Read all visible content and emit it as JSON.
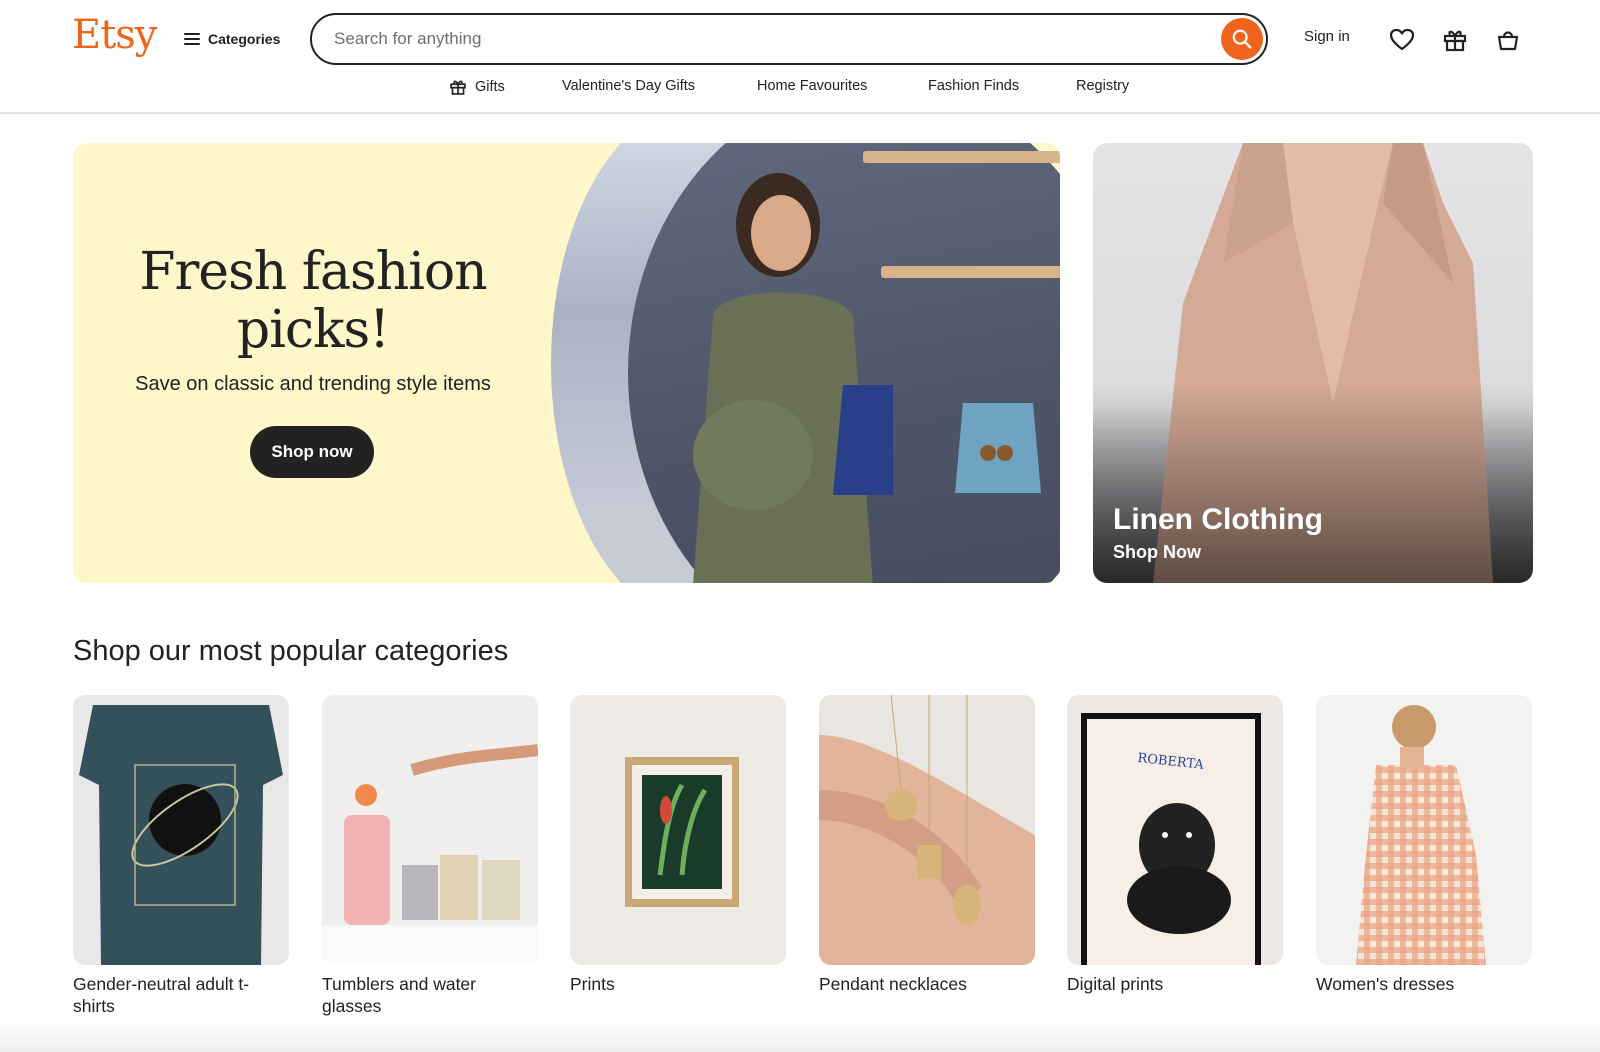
{
  "header": {
    "logo": "Etsy",
    "categories_label": "Categories",
    "search_placeholder": "Search for anything",
    "sign_in": "Sign in"
  },
  "subnav": {
    "items": [
      "Gifts",
      "Valentine's Day Gifts",
      "Home Favourites",
      "Fashion Finds",
      "Registry"
    ]
  },
  "hero": {
    "title_line1": "Fresh fashion",
    "title_line2": "picks!",
    "subtitle": "Save on classic and trending style items",
    "button": "Shop now"
  },
  "side_card": {
    "title": "Linen Clothing",
    "subtitle": "Shop Now"
  },
  "popular": {
    "title": "Shop our most popular categories",
    "items": [
      {
        "label": "Gender-neutral adult t-shirts"
      },
      {
        "label": "Tumblers and water glasses"
      },
      {
        "label": "Prints"
      },
      {
        "label": "Pendant necklaces"
      },
      {
        "label": "Digital prints"
      },
      {
        "label": "Women's dresses"
      }
    ]
  },
  "dog_print_text": "ROBERTA",
  "colors": {
    "brand": "#f1641e",
    "hero_bg": "#fdf7c9",
    "text": "#222222"
  },
  "icons": [
    "menu-icon",
    "search-icon",
    "heart-icon",
    "gift-icon",
    "cart-icon"
  ]
}
